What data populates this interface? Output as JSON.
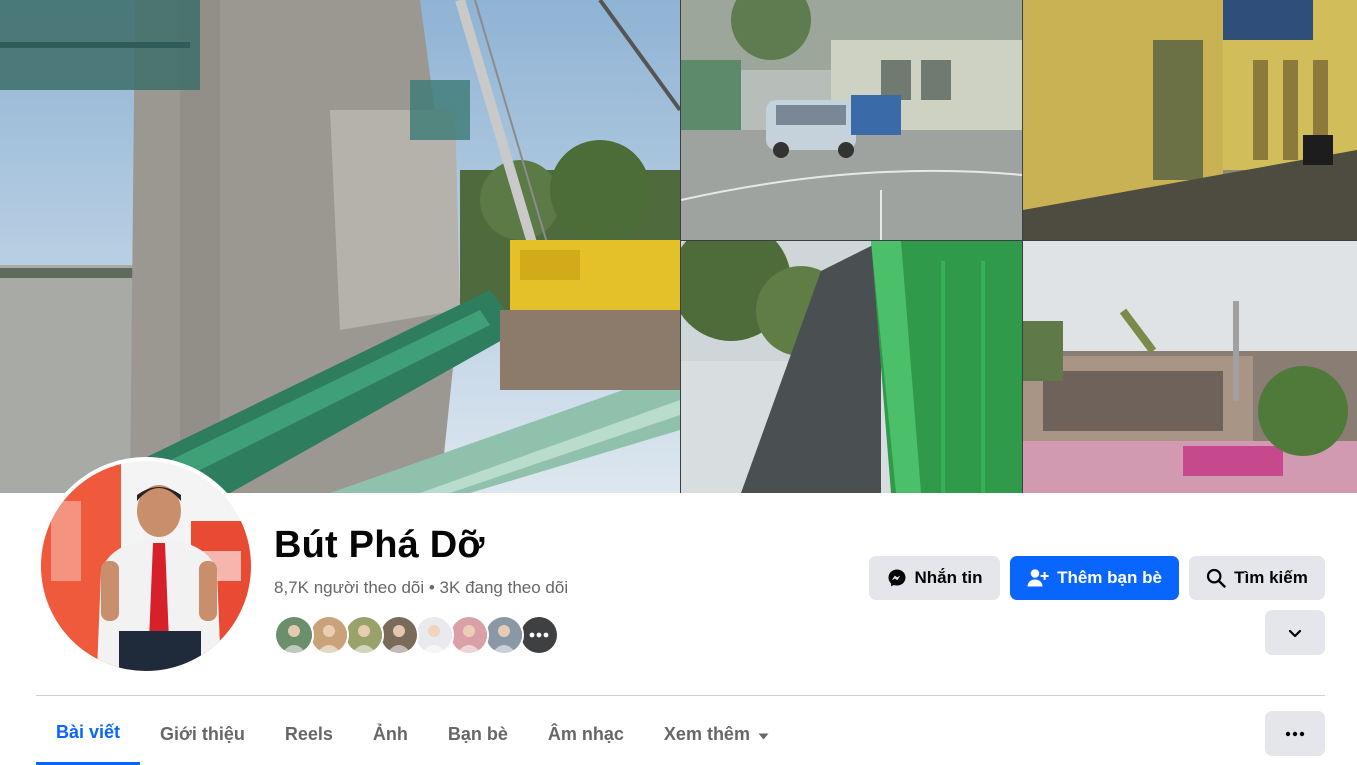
{
  "profile": {
    "name": "Bút Phá Dỡ",
    "followers": "8,7K người theo dõi",
    "separator": " • ",
    "following": "3K đang theo dõi"
  },
  "friends": [
    {
      "icon": "friend-avatar",
      "bg": "#6b8e6b"
    },
    {
      "icon": "friend-avatar",
      "bg": "#c9a27a"
    },
    {
      "icon": "friend-avatar",
      "bg": "#9aa26b"
    },
    {
      "icon": "friend-avatar",
      "bg": "#7a6a5a"
    },
    {
      "icon": "friend-avatar",
      "bg": "#e8eaee"
    },
    {
      "icon": "friend-avatar",
      "bg": "#d9a0a8"
    },
    {
      "icon": "friend-avatar",
      "bg": "#8a98a6"
    },
    {
      "icon": "more-dots-icon",
      "bg": "#3e4042"
    }
  ],
  "actions": {
    "message_label": "Nhắn tin",
    "add_friend_label": "Thêm bạn bè",
    "search_label": "Tìm kiếm"
  },
  "tabs": [
    {
      "label": "Bài viết",
      "active": true
    },
    {
      "label": "Giới thiệu",
      "active": false
    },
    {
      "label": "Reels",
      "active": false
    },
    {
      "label": "Ảnh",
      "active": false
    },
    {
      "label": "Bạn bè",
      "active": false
    },
    {
      "label": "Âm nhạc",
      "active": false
    },
    {
      "label": "Xem thêm",
      "active": false
    }
  ],
  "colors": {
    "accent": "#0866ff",
    "button_grey": "#e4e6eb",
    "secondary_text": "#65676b",
    "divider": "#ced0d4"
  }
}
